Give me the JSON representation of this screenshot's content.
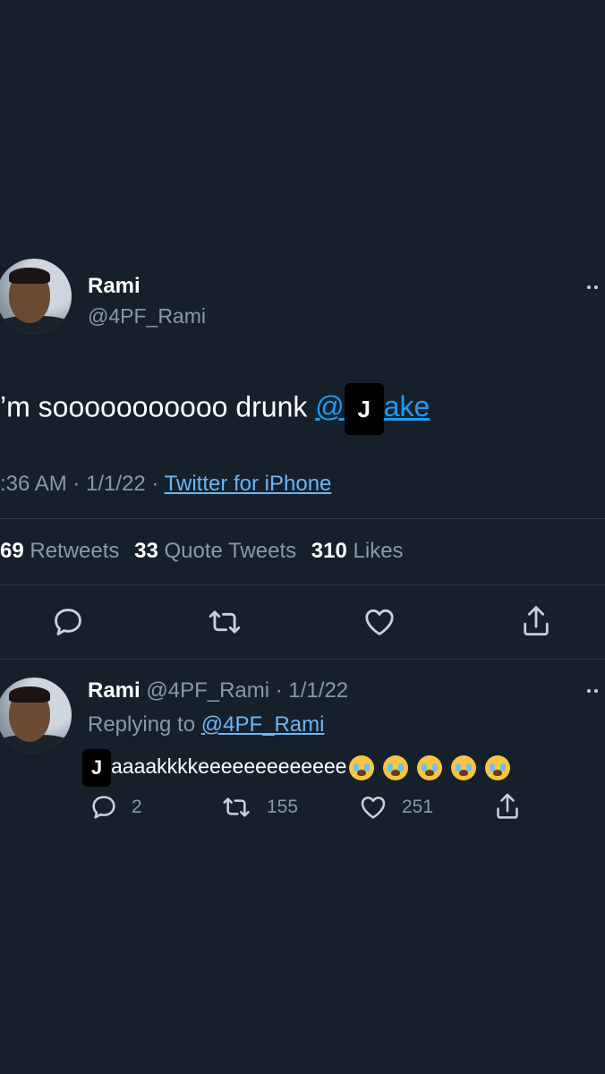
{
  "main_tweet": {
    "display_name": "Rami",
    "handle": "@4PF_Rami",
    "text_prefix": "’m sooooooooooo drunk ",
    "mention_at": "@",
    "mention_redaction": "J",
    "mention_rest": "ake",
    "time": ":36 AM · 1/1/22 · ",
    "source": "Twitter for iPhone",
    "retweets_count": "69",
    "retweets_label": "Retweets",
    "quotes_count": "33",
    "quotes_label": "Quote Tweets",
    "likes_count": "310",
    "likes_label": "Likes",
    "actions": [
      "reply-icon",
      "retweet-icon",
      "like-icon",
      "share-icon"
    ]
  },
  "reply_tweet": {
    "display_name": "Rami",
    "meta": "@4PF_Rami · 1/1/22",
    "replying_prefix": "Replying to ",
    "replying_handle": "@4PF_Rami",
    "text_redaction": "J",
    "text": "aaaakkkkeeeeeeeeeeeee",
    "emoji_name": "loudly-crying-face",
    "emoji_count": 5,
    "reply_count": "2",
    "retweet_count": "155",
    "like_count": "251"
  },
  "colors": {
    "background": "#15202b",
    "link": "#1d9bf0",
    "muted": "#8b98a5",
    "divider": "#2c3640"
  }
}
